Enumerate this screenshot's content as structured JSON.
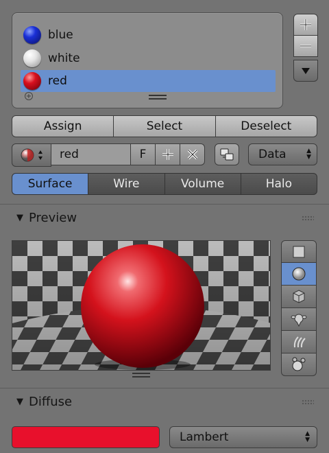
{
  "material_slots": {
    "items": [
      {
        "label": "blue",
        "color": "#1a2fd6"
      },
      {
        "label": "white",
        "color": "#e6e6e6"
      },
      {
        "label": "red",
        "color": "#d8101f",
        "selected": true
      }
    ]
  },
  "slot_buttons": {
    "add_symbol": "+",
    "remove_symbol": "−"
  },
  "assign_row": {
    "assign": "Assign",
    "select": "Select",
    "deselect": "Deselect"
  },
  "material_id": {
    "name": "red",
    "fake_user": "F",
    "data_dropdown": "Data"
  },
  "tabs": [
    "Surface",
    "Wire",
    "Volume",
    "Halo"
  ],
  "preview_panel": {
    "title": "Preview",
    "shape_buttons": [
      "flat-plane",
      "sphere",
      "cube",
      "monkey",
      "hair-strands",
      "sphere-sky"
    ],
    "active_shape": "sphere"
  },
  "diffuse_panel": {
    "title": "Diffuse",
    "color": "#e8102c",
    "shader": "Lambert"
  }
}
